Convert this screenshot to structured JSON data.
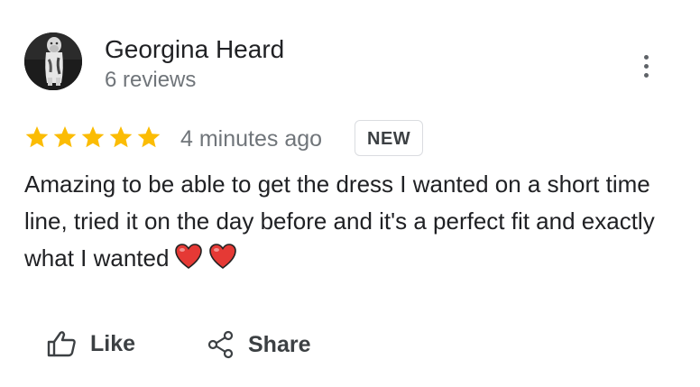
{
  "review": {
    "author_name": "Georgina Heard",
    "author_reviews": "6 reviews",
    "rating": 5,
    "rating_max": 5,
    "time_ago": "4 minutes ago",
    "badge": "NEW",
    "text": "Amazing to be able to get the dress I wanted on a short time line, tried it on the day before and it's a perfect fit and exactly what I wanted",
    "emoji": [
      "heart",
      "heart"
    ]
  },
  "actions": {
    "like_label": "Like",
    "share_label": "Share"
  },
  "icons": {
    "star": "star-icon",
    "heart": "red-heart-icon",
    "like": "thumbs-up-icon",
    "share": "share-icon",
    "more": "more-vert-icon"
  },
  "colors": {
    "star": "#fbbc04",
    "heart": "#e53935",
    "muted_text": "#70757a",
    "text": "#202124"
  }
}
